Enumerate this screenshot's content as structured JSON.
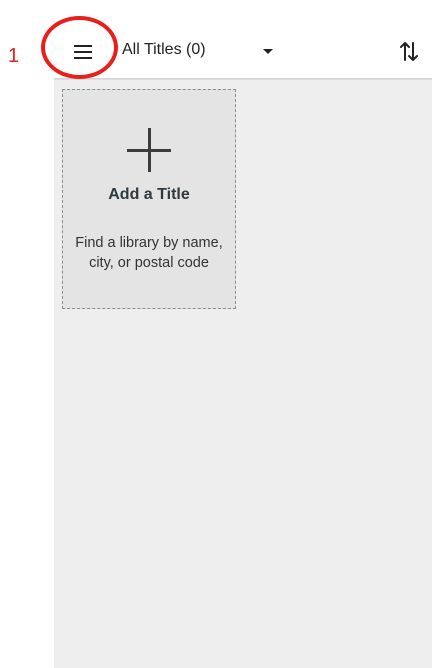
{
  "annotation": {
    "step_number": "1",
    "ring_color": "#e8201c"
  },
  "toolbar": {
    "menu_icon": "hamburger-menu-icon",
    "filter_label": "All Titles (0)",
    "dropdown_icon": "caret-down-icon",
    "sort_icon": "sort-arrows-icon"
  },
  "add_card": {
    "icon": "plus-icon",
    "title": "Add a Title",
    "description": "Find a library by name, city, or postal code"
  },
  "colors": {
    "content_background": "#eeeeee",
    "card_background": "#e4e4e4",
    "text_dark": "#2f3940"
  }
}
